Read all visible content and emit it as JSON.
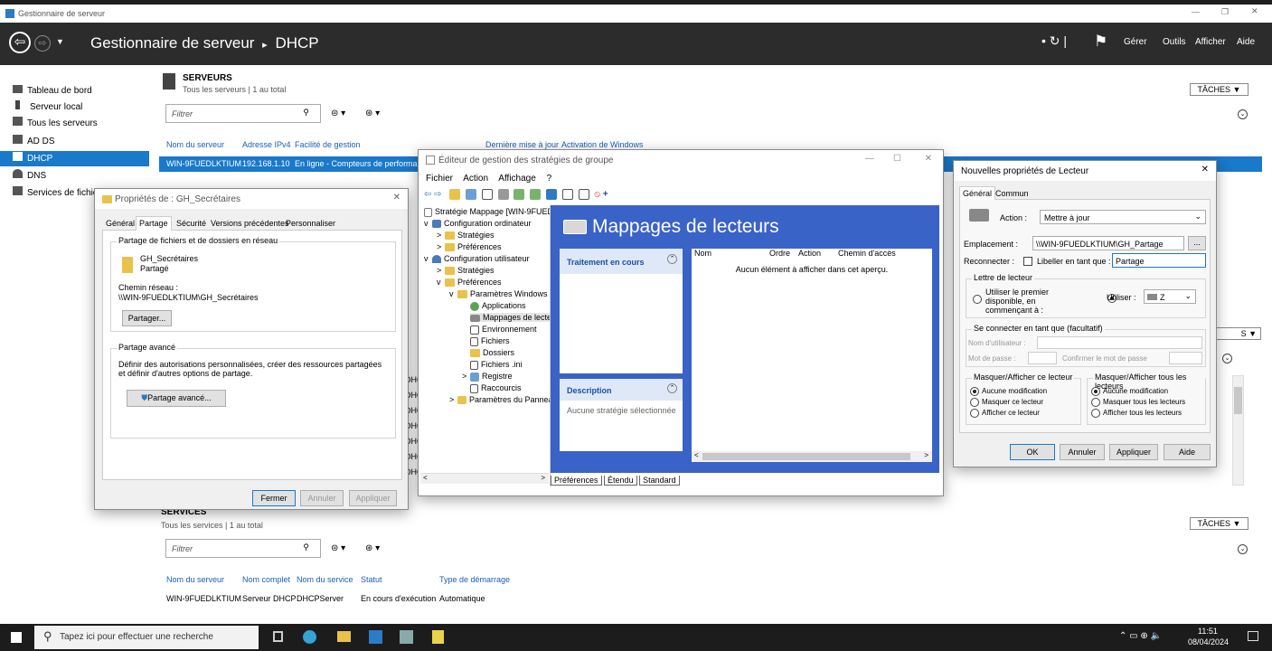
{
  "sm": {
    "window_title": "Gestionnaire de serveur",
    "breadcrumb_root": "Gestionnaire de serveur",
    "breadcrumb_sep": "▸",
    "breadcrumb_current": "DHCP",
    "menu": [
      "Gérer",
      "Outils",
      "Afficher",
      "Aide"
    ],
    "sidebar": [
      {
        "icon": "dashboard-icon",
        "label": "Tableau de bord"
      },
      {
        "icon": "server-icon",
        "label": "Serveur local"
      },
      {
        "icon": "servers-icon",
        "label": "Tous les serveurs"
      },
      {
        "icon": "adds-icon",
        "label": "AD DS"
      },
      {
        "icon": "dhcp-icon",
        "label": "DHCP"
      },
      {
        "icon": "dns-icon",
        "label": "DNS"
      },
      {
        "icon": "file-services-icon",
        "label": "Services de fichiers et d..."
      }
    ],
    "servers": {
      "title": "SERVEURS",
      "subtitle": "Tous les serveurs | 1 au total",
      "tasks": "TÂCHES",
      "filter_placeholder": "Filtrer",
      "columns": [
        "Nom du serveur",
        "Adresse IPv4",
        "Facilité de gestion",
        "Dernière mise à jour",
        "Activation de Windows"
      ],
      "row": [
        "WIN-9FUEDLKTIUM",
        "192.168.1.10",
        "En ligne - Compteurs de performance non démarrés"
      ]
    },
    "events_partial": [
      "DHCP-",
      "DHCP-",
      "DHCP-",
      "DHCP-",
      "DHCP-",
      "DHCP-",
      "DHCP-"
    ],
    "services": {
      "title": "SERVICES",
      "subtitle": "Tous les services | 1 au total",
      "tasks": "TÂCHES",
      "filter_placeholder": "Filtrer",
      "columns": [
        "Nom du serveur",
        "Nom complet",
        "Nom du service",
        "Statut",
        "Type de démarrage"
      ],
      "row": [
        "WIN-9FUEDLKTIUM",
        "Serveur DHCP",
        "DHCPServer",
        "En cours d'exécution",
        "Automatique"
      ]
    }
  },
  "props": {
    "title": "Propriétés de : GH_Secrétaires",
    "tabs": [
      "Général",
      "Partage",
      "Sécurité",
      "Versions précédentes",
      "Personnaliser"
    ],
    "active_tab": "Partage",
    "g1_label": "Partage de fichiers et de dossiers en réseau",
    "share_name": "GH_Secrétaires",
    "share_state": "Partagé",
    "path_label": "Chemin réseau :",
    "path_value": "\\\\WIN-9FUEDLKTIUM\\GH_Secrétaires",
    "share_btn": "Partager...",
    "g2_label": "Partage avancé",
    "g2_desc": "Définir des autorisations personnalisées, créer des ressources partagées et définir d'autres options de partage.",
    "adv_btn": "Partage avancé...",
    "buttons": [
      "Fermer",
      "Annuler",
      "Appliquer"
    ]
  },
  "gpo": {
    "title": "Éditeur de gestion des stratégies de groupe",
    "menu": [
      "Fichier",
      "Action",
      "Affichage",
      "?"
    ],
    "tree": [
      {
        "label": "Stratégie Mappage [WIN-9FUEDLKTIUM]",
        "d": 0,
        "x": "",
        "i": "policy-icon"
      },
      {
        "label": "Configuration ordinateur",
        "d": 0,
        "x": "v",
        "i": "computer-icon"
      },
      {
        "label": "Stratégies",
        "d": 1,
        "x": ">",
        "i": "folder-icon"
      },
      {
        "label": "Préférences",
        "d": 1,
        "x": ">",
        "i": "folder-icon"
      },
      {
        "label": "Configuration utilisateur",
        "d": 0,
        "x": "v",
        "i": "user-icon"
      },
      {
        "label": "Stratégies",
        "d": 1,
        "x": ">",
        "i": "folder-icon"
      },
      {
        "label": "Préférences",
        "d": 1,
        "x": "v",
        "i": "folder-icon"
      },
      {
        "label": "Paramètres Windows",
        "d": 2,
        "x": "v",
        "i": "folder-icon"
      },
      {
        "label": "Applications",
        "d": 3,
        "x": "",
        "i": "applications-icon"
      },
      {
        "label": "Mappages de lecteurs",
        "d": 3,
        "x": "",
        "i": "drive-map-icon"
      },
      {
        "label": "Environnement",
        "d": 3,
        "x": "",
        "i": "environment-icon"
      },
      {
        "label": "Fichiers",
        "d": 3,
        "x": "",
        "i": "files-icon"
      },
      {
        "label": "Dossiers",
        "d": 3,
        "x": "",
        "i": "folders-icon"
      },
      {
        "label": "Fichiers .ini",
        "d": 3,
        "x": "",
        "i": "ini-icon"
      },
      {
        "label": "Registre",
        "d": 3,
        "x": ">",
        "i": "registry-icon"
      },
      {
        "label": "Raccourcis",
        "d": 3,
        "x": "",
        "i": "shortcuts-icon"
      },
      {
        "label": "Paramètres du Panneau de configuration",
        "d": 2,
        "x": ">",
        "i": "control-panel-icon"
      }
    ],
    "heading": "Mappages de lecteurs",
    "processing": "Traitement en cours",
    "description": "Description",
    "desc_text": "Aucune stratégie sélectionnée",
    "columns": [
      "Nom",
      "Ordre",
      "Action",
      "Chemin d'accès"
    ],
    "empty": "Aucun élément à afficher dans cet aperçu.",
    "tabs": [
      "Préférences",
      "Étendu",
      "Standard"
    ]
  },
  "drive": {
    "title": "Nouvelles propriétés de Lecteur",
    "tabs": [
      "Général",
      "Commun"
    ],
    "action_label": "Action :",
    "action_value": "Mettre à jour",
    "location_label": "Emplacement :",
    "location_value": "\\\\WIN-9FUEDLKTIUM\\GH_Partage",
    "browse": "...",
    "reconnect_label": "Reconnecter :",
    "label_as": "Libeller en tant que :",
    "label_value": "Partage",
    "letter_group": "Lettre de lecteur",
    "first_available": "Utiliser le premier disponible, en commençant à :",
    "use": "Utiliser :",
    "letter": "Z",
    "connect_group": "Se connecter en tant que (facultatif)",
    "username": "Nom d'utilisateur :",
    "password": "Mot de passe :",
    "confirm": "Confirmer le mot de passe",
    "hide_group": "Masquer/Afficher ce lecteur",
    "hide_opts": [
      "Aucune modification",
      "Masquer ce lecteur",
      "Afficher ce lecteur"
    ],
    "hideall_group": "Masquer/Afficher tous les lecteurs",
    "hideall_opts": [
      "Aucune modification",
      "Masquer tous les lecteurs",
      "Afficher tous les lecteurs"
    ],
    "buttons": [
      "OK",
      "Annuler",
      "Appliquer",
      "Aide"
    ]
  },
  "taskbar": {
    "search": "Tapez ici pour effectuer une recherche",
    "time": "11:51",
    "date": "08/04/2024"
  }
}
